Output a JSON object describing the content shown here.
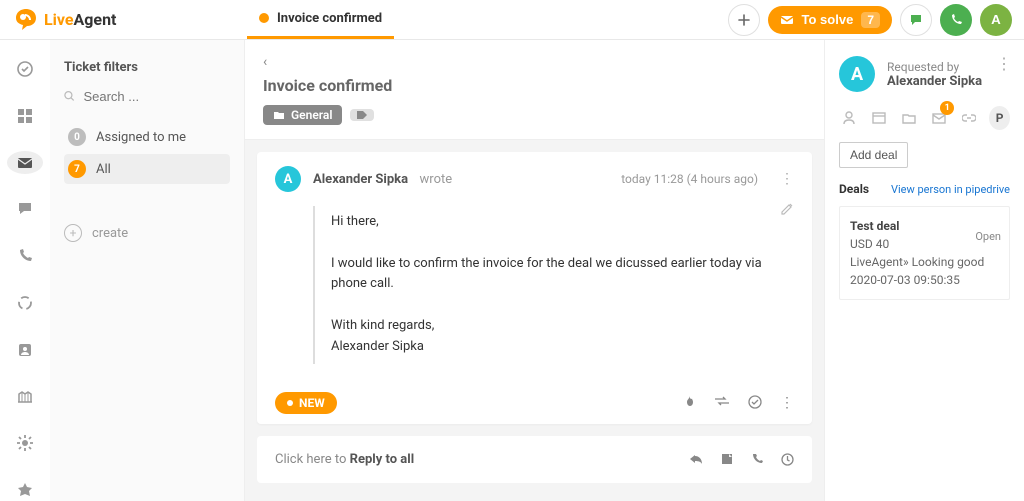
{
  "brand": {
    "live": "Live",
    "agent": "Agent"
  },
  "header": {
    "tab_title": "Invoice confirmed",
    "to_solve_label": "To solve",
    "to_solve_count": "7",
    "user_initial": "A"
  },
  "filters": {
    "title": "Ticket filters",
    "search_placeholder": "Search ...",
    "items": [
      {
        "count": "0",
        "label": "Assigned to me"
      },
      {
        "count": "7",
        "label": "All"
      }
    ],
    "create_label": "create"
  },
  "ticket": {
    "title": "Invoice confirmed",
    "general_tag": "General",
    "author": "Alexander Sipka",
    "wrote": "wrote",
    "time": "today 11:28 (4 hours ago)",
    "greeting": "Hi there,",
    "body": "I would like to confirm the invoice for the deal we dicussed earlier today via phone call.",
    "regards": "With kind regards,",
    "signature": "Alexander Sipka",
    "new_label": "NEW",
    "reply_prefix": "Click here to ",
    "reply_action": "Reply to all"
  },
  "right": {
    "requested_by": "Requested by",
    "requester_name": "Alexander Sipka",
    "requester_initial": "A",
    "badge_count": "1",
    "p_label": "P",
    "add_deal": "Add deal",
    "deals_title": "Deals",
    "pipedrive_link": "View person in pipedrive",
    "deal": {
      "name": "Test deal",
      "currency": "USD",
      "amount": "40",
      "org": "LiveAgent»",
      "status": "Looking good",
      "date": "2020-07-03 09:50:35",
      "open": "Open"
    }
  }
}
